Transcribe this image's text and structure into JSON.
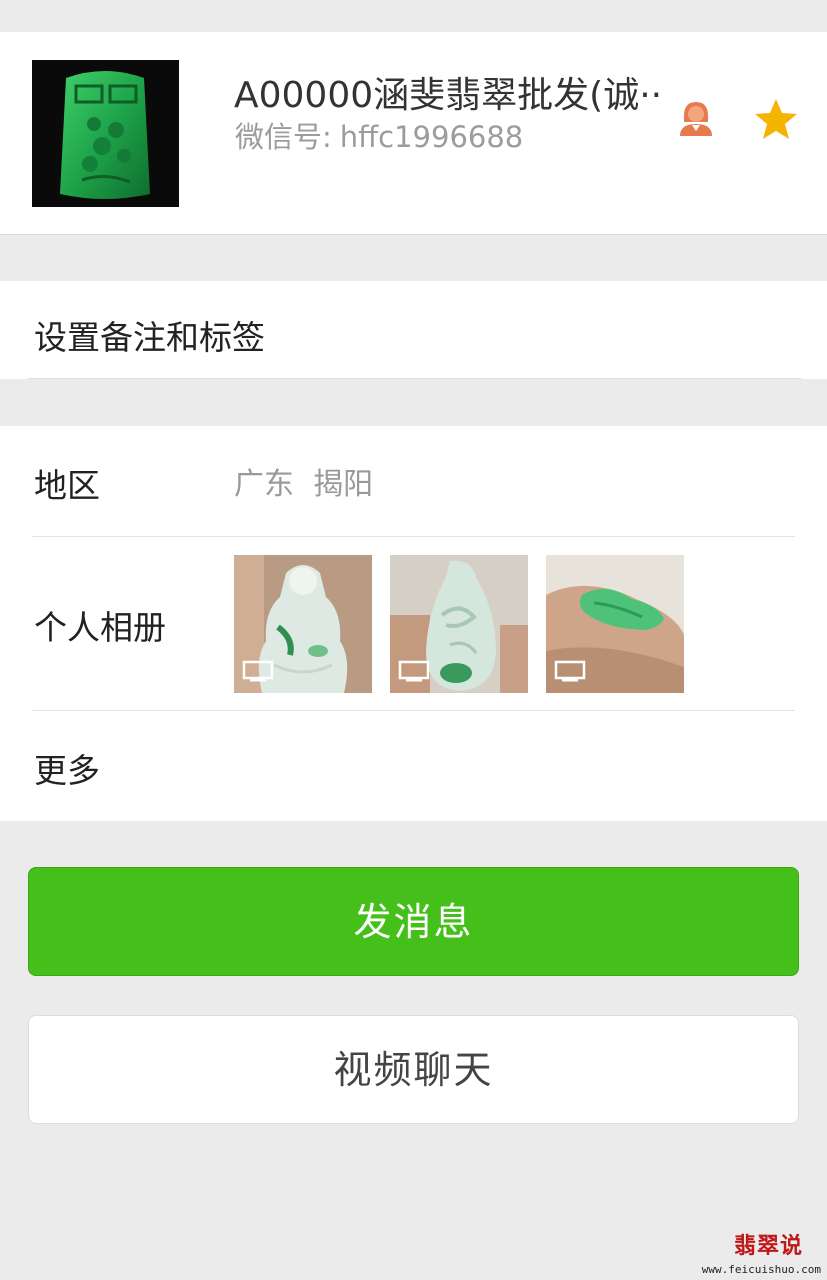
{
  "profile": {
    "name": "A00000涵斐翡翠批发(诚··",
    "wechat_id_label": "微信号:",
    "wechat_id": "hffc1996688",
    "gender_icon": "person-female-icon",
    "star_icon": "star-icon",
    "star_color": "#f5b400"
  },
  "remark": {
    "label": "设置备注和标签"
  },
  "info": {
    "region_label": "地区",
    "region_value": "广东  揭阳",
    "album_label": "个人相册",
    "more_label": "更多",
    "video_badge_icon": "video-icon"
  },
  "actions": {
    "send_message": "发消息",
    "video_chat": "视频聊天",
    "primary_color": "#45c01a"
  },
  "watermark": {
    "title": "翡翠说",
    "url": "www.feicuishuo.com"
  }
}
